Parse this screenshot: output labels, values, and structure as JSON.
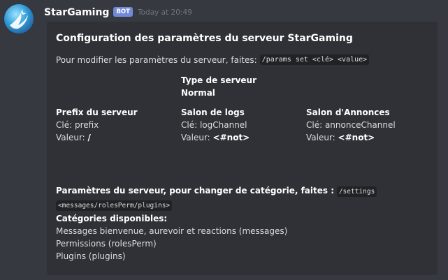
{
  "message": {
    "username": "StarGaming",
    "badge": "BOT",
    "timestamp": "Today at 20:49",
    "avatar_icon": "star-logo-icon"
  },
  "embed": {
    "title": "Configuration des paramètres du serveur StarGaming",
    "description_text": "Pour modifier les paramètres du serveur, faites:",
    "description_code": "/params set <clé> <value>",
    "server_type": {
      "name": "Type de serveur",
      "value": "Normal"
    },
    "fields": [
      {
        "name": "Prefix du serveur",
        "key_line": "Clé: prefix",
        "value_label": "Valeur:",
        "value": "/"
      },
      {
        "name": "Salon de logs",
        "key_line": "Clé: logChannel",
        "value_label": "Valeur:",
        "value": "<#not>"
      },
      {
        "name": "Salon d'Annonces",
        "key_line": "Clé: annonceChannel",
        "value_label": "Valeur:",
        "value": "<#not>"
      }
    ],
    "settings": {
      "name": "Paramètres du serveur, pour changer de catégorie, faites :",
      "code_command": "/settings",
      "code_args": "<messages/rolesPerm/plugins>",
      "categories_title": "Catégories disponibles:",
      "categories": [
        "Messages bienvenue, aurevoir et reactions (messages)",
        "Permissions (rolesPerm)",
        "Plugins (plugins)"
      ]
    }
  },
  "colors": {
    "background": "#36393f",
    "embed": "#2f3136",
    "badge": "#7289da"
  }
}
